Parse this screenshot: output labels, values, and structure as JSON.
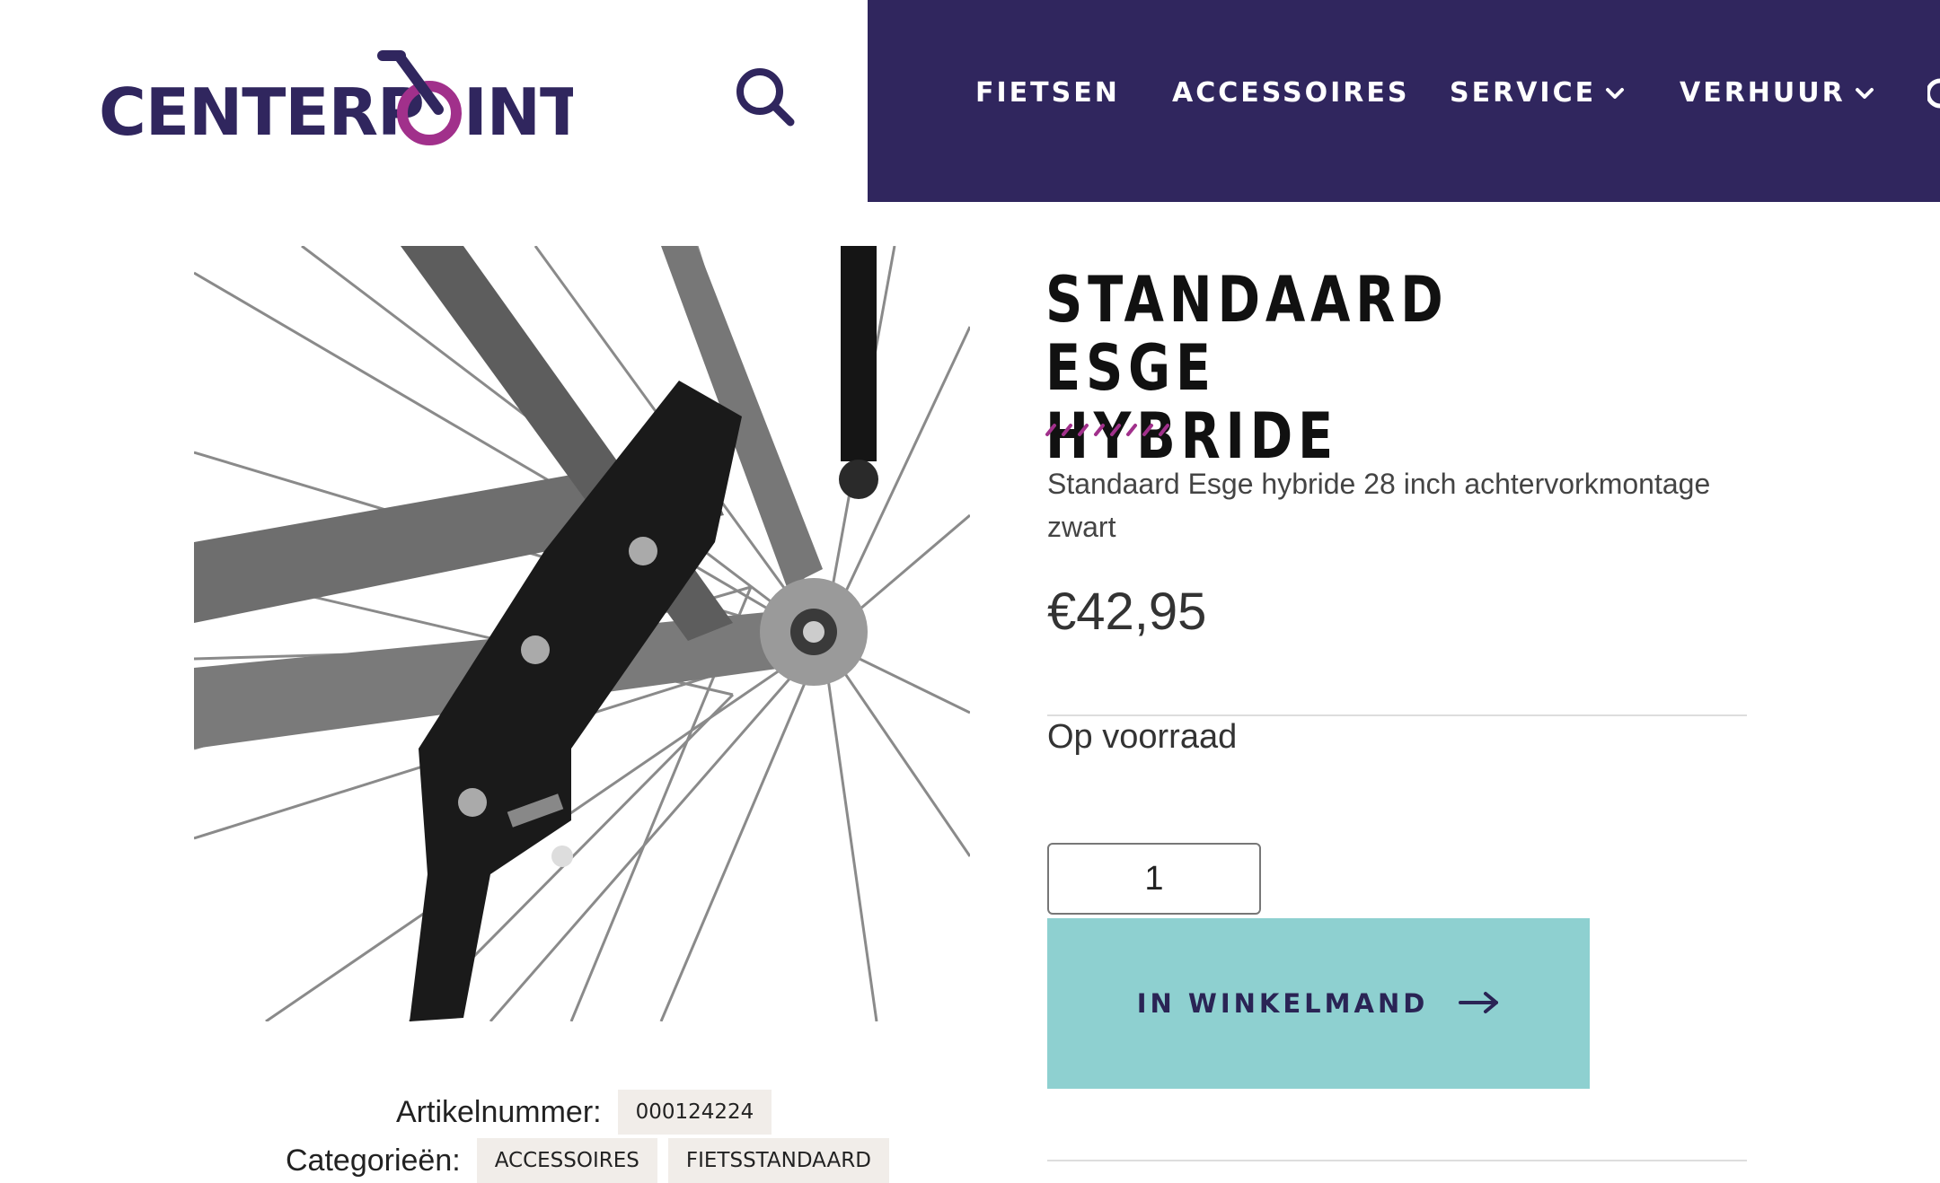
{
  "header": {
    "logo": {
      "text": "CENTERPOINT",
      "brand_color": "#30265e",
      "accent_color": "#a1308b"
    },
    "search_icon": "search-icon",
    "nav_background": "#30265e",
    "nav": [
      {
        "label": "FIETSEN",
        "has_dropdown": false
      },
      {
        "label": "ACCESSOIRES",
        "has_dropdown": false
      },
      {
        "label": "SERVICE",
        "has_dropdown": true
      },
      {
        "label": "VERHUUR",
        "has_dropdown": true
      }
    ]
  },
  "product": {
    "title_lines": [
      "STANDAARD ESGE",
      "HYBRIDE"
    ],
    "short_description": "Standaard Esge hybride 28 inch achtervorkmontage zwart",
    "price": "€42,95",
    "stock_status": "Op voorraad",
    "quantity": "1",
    "add_to_cart_label": "IN WINKELMAND",
    "cart_button_color": "#8ed0d0",
    "image_subject": "black kickstand mounted on bicycle rear fork with wheel spokes",
    "meta": {
      "sku_label": "Artikelnummer:",
      "sku": "000124224",
      "categories_label": "Categorieën:",
      "categories": [
        "ACCESSOIRES",
        "FIETSSTANDAARD"
      ]
    }
  }
}
